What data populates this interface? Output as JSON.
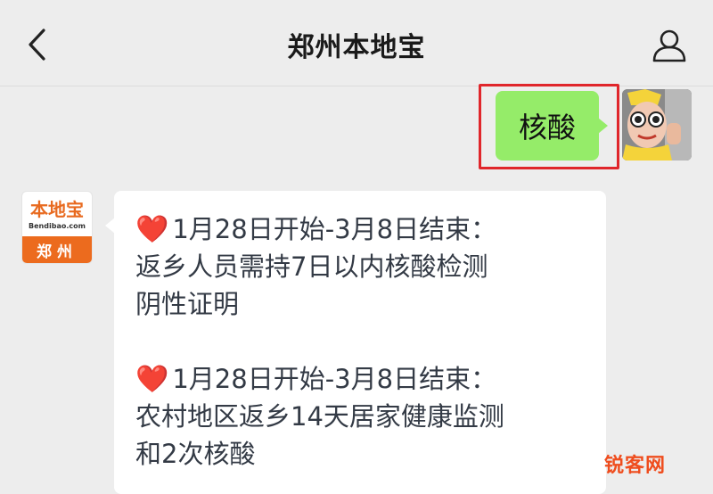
{
  "header": {
    "title": "郑州本地宝",
    "back_icon": "chevron-left-icon",
    "profile_icon": "person-icon"
  },
  "messages": {
    "outgoing": {
      "text": "核酸",
      "bubble_color": "#95ec69",
      "highlight_color": "#e0262b"
    },
    "incoming": {
      "avatar": {
        "logo_text": "本地宝",
        "logo_url": "Bendibao.com",
        "city": "郑州"
      },
      "paragraph1": {
        "heart": "❤️",
        "line1": "1月28日开始-3月8日结束：",
        "line2": "返乡人员需持7日以内核酸检测",
        "line3": "阴性证明"
      },
      "paragraph2": {
        "heart": "❤️",
        "line1": "1月28日开始-3月8日结束：",
        "line2": "农村地区返乡14天居家健康监测",
        "line3": "和2次核酸"
      }
    }
  },
  "watermark": "锐客网"
}
